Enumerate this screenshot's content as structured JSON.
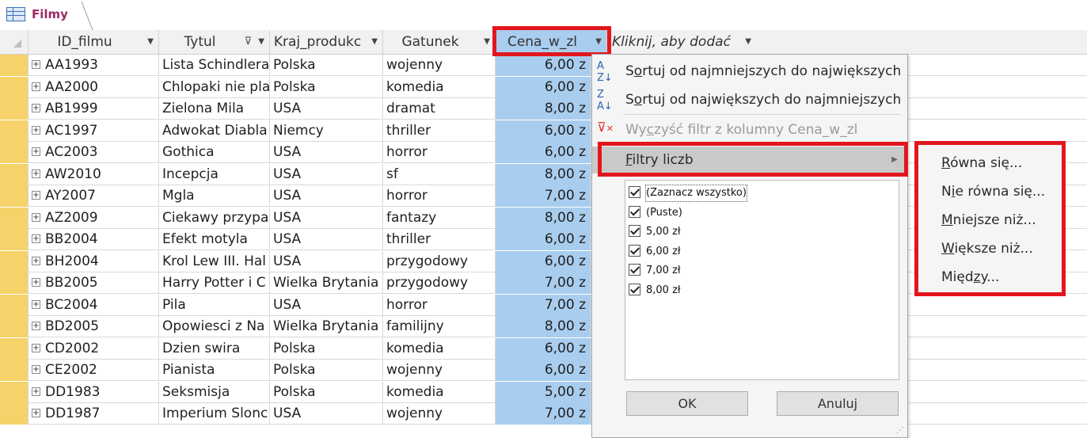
{
  "table": {
    "tab_title": "Filmy",
    "columns": [
      "ID_filmu",
      "Tytul",
      "Kraj_produkc",
      "Gatunek",
      "Cena_w_zl",
      "Kliknij, aby dodać"
    ],
    "rows": [
      [
        "AA1993",
        "Lista Schindlera",
        "Polska",
        "wojenny",
        "6,00 z"
      ],
      [
        "AA2000",
        "Chlopaki nie pla",
        "Polska",
        "komedia",
        "6,00 z"
      ],
      [
        "AB1999",
        "Zielona Mila",
        "USA",
        "dramat",
        "8,00 z"
      ],
      [
        "AC1997",
        "Adwokat Diabla",
        "Niemcy",
        "thriller",
        "6,00 z"
      ],
      [
        "AC2003",
        "Gothica",
        "USA",
        "horror",
        "6,00 z"
      ],
      [
        "AW2010",
        "Incepcja",
        "USA",
        "sf",
        "8,00 z"
      ],
      [
        "AY2007",
        "Mgla",
        "USA",
        "horror",
        "7,00 z"
      ],
      [
        "AZ2009",
        "Ciekawy przypa",
        "USA",
        "fantazy",
        "8,00 z"
      ],
      [
        "BB2004",
        "Efekt motyla",
        "USA",
        "thriller",
        "6,00 z"
      ],
      [
        "BH2004",
        "Krol Lew III. Hal",
        "USA",
        "przygodowy",
        "6,00 z"
      ],
      [
        "BB2005",
        "Harry Potter i C",
        "Wielka Brytania",
        "przygodowy",
        "7,00 z"
      ],
      [
        "BC2004",
        "Pila",
        "USA",
        "horror",
        "7,00 z"
      ],
      [
        "BD2005",
        "Opowiesci z Na",
        "Wielka Brytania",
        "familijny",
        "8,00 z"
      ],
      [
        "CD2002",
        "Dzien swira",
        "Polska",
        "komedia",
        "6,00 z"
      ],
      [
        "CE2002",
        "Pianista",
        "Polska",
        "wojenny",
        "6,00 z"
      ],
      [
        "DD1983",
        "Seksmisja",
        "Polska",
        "komedia",
        "5,00 z"
      ],
      [
        "DD1987",
        "Imperium Slonc",
        "USA",
        "wojenny",
        "7,00 z"
      ]
    ]
  },
  "menu": {
    "sort_asc": {
      "pre": "S",
      "key": "o",
      "post": "rtuj od najmniejszych do największych"
    },
    "sort_desc": {
      "pre": "S",
      "key": "o",
      "post": "rtuj od największych do najmniejszych"
    },
    "clear_filter": {
      "pre": "Wy",
      "key": "c",
      "post": "zyść filtr z kolumny Cena_w_zl"
    },
    "number_filters": {
      "pre": "",
      "key": "F",
      "post": "iltry liczb"
    },
    "checklist": [
      "(Zaznacz wszystko)",
      "(Puste)",
      "5,00 zł",
      "6,00 zł",
      "7,00 zł",
      "8,00 zł"
    ],
    "ok_label": "OK",
    "cancel_label": "Anuluj"
  },
  "submenu": {
    "items": [
      {
        "pre": "",
        "key": "R",
        "post": "ówna się..."
      },
      {
        "pre": "N",
        "key": "i",
        "post": "e równa się..."
      },
      {
        "pre": "",
        "key": "M",
        "post": "niejsze niż..."
      },
      {
        "pre": "",
        "key": "W",
        "post": "iększe niż..."
      },
      {
        "pre": "Międ",
        "key": "z",
        "post": "y..."
      }
    ]
  },
  "colors": {
    "selected_column": "#a9cdee",
    "highlight_box": "#e3161e",
    "record_selector": "#f6d36a"
  }
}
